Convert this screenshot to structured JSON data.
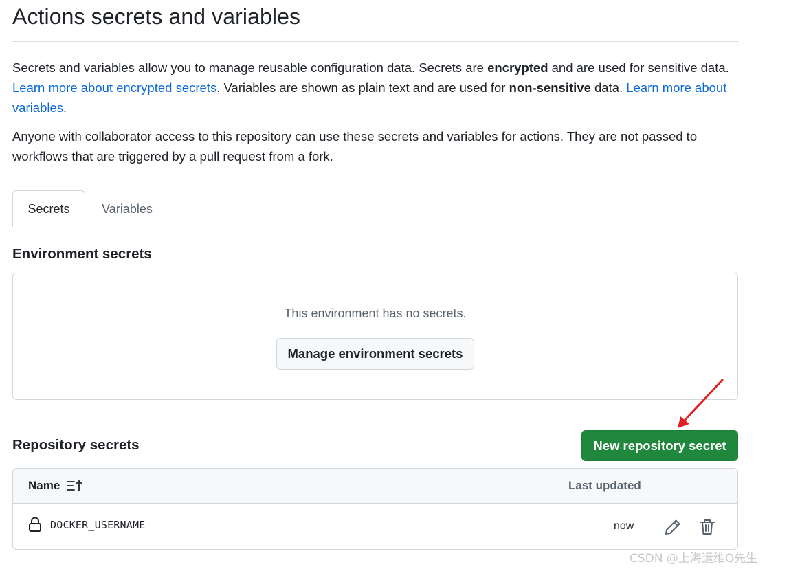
{
  "page": {
    "title": "Actions secrets and variables",
    "intro": {
      "t1": "Secrets and variables allow you to manage reusable configuration data. Secrets are ",
      "b1": "encrypted",
      "t2": " and are used for sensitive data. ",
      "link1": "Learn more about encrypted secrets",
      "t3": ". Variables are shown as plain text and are used for ",
      "b2": "non-sensitive",
      "t4": " data. ",
      "link2": "Learn more about variables",
      "t5": "."
    },
    "access_note": "Anyone with collaborator access to this repository can use these secrets and variables for actions. They are not passed to workflows that are triggered by a pull request from a fork."
  },
  "tabs": [
    {
      "label": "Secrets",
      "selected": true
    },
    {
      "label": "Variables",
      "selected": false
    }
  ],
  "environment_secrets": {
    "heading": "Environment secrets",
    "empty_text": "This environment has no secrets.",
    "manage_button": "Manage environment secrets"
  },
  "repository_secrets": {
    "heading": "Repository secrets",
    "new_button": "New repository secret",
    "columns": {
      "name": "Name",
      "last_updated": "Last updated"
    },
    "rows": [
      {
        "name": "DOCKER_USERNAME",
        "updated": "now"
      }
    ]
  },
  "watermark": "CSDN @上海运维Q先生",
  "colors": {
    "link": "#0969da",
    "primary_button": "#1f883d",
    "annotation_arrow": "#e02020",
    "border": "#d0d7de"
  },
  "icons": {
    "sort": "sort-ascending-icon",
    "lock": "lock-icon",
    "edit": "pencil-icon",
    "delete": "trash-icon"
  }
}
